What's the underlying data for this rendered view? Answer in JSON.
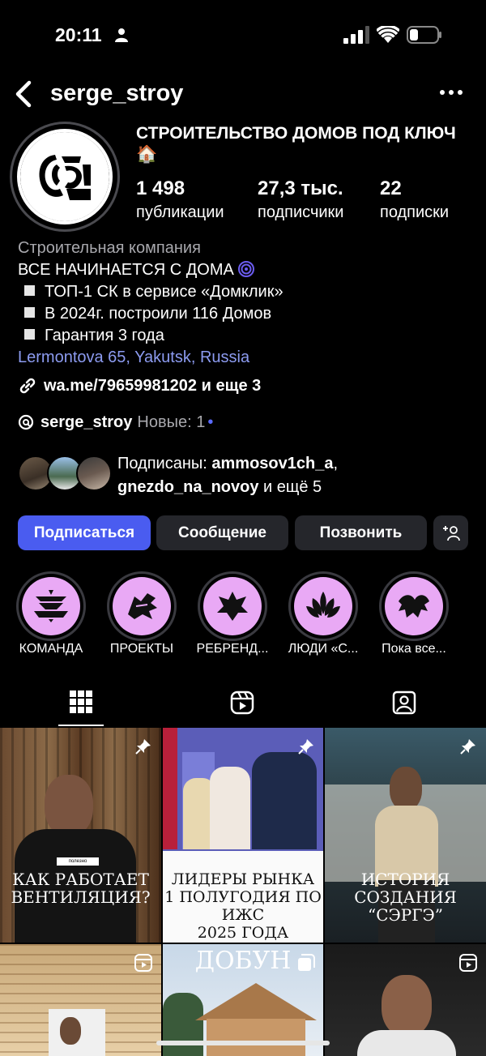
{
  "status": {
    "time": "20:11"
  },
  "header": {
    "username": "serge_stroy"
  },
  "profile": {
    "name": "СТРОИТЕЛЬСТВО ДОМОВ ПОД КЛЮЧ🏠",
    "stats": [
      {
        "value": "1 498",
        "label": "публикации"
      },
      {
        "value": "27,3 тыс.",
        "label": "подписчики"
      },
      {
        "value": "22",
        "label": "подписки"
      }
    ],
    "category": "Строительная компания",
    "bio_lines": [
      "ВСЕ НАЧИНАЕТСЯ С ДОМА",
      "ТОП-1 СК в сервисе «Домклик»",
      "В 2024г. построили 116 Домов",
      "Гарантия 3 года"
    ],
    "location": "Lermontova 65, Yakutsk, Russia",
    "link": "wa.me/79659981202 и еще 3",
    "threads_handle": "serge_stroy",
    "threads_new": "Новые: 1",
    "followed_prefix": "Подписаны: ",
    "followed_user1": "ammosov1ch_a",
    "followed_user2": "gnezdo_na_novoy",
    "followed_suffix": " и ещё 5"
  },
  "buttons": {
    "follow": "Подписаться",
    "message": "Сообщение",
    "call": "Позвонить"
  },
  "highlights": [
    {
      "label": "КОМАНДА"
    },
    {
      "label": "ПРОЕКТЫ"
    },
    {
      "label": "РЕБРЕНД..."
    },
    {
      "label": "ЛЮДИ «С..."
    },
    {
      "label": "Пока все..."
    }
  ],
  "posts": [
    {
      "title_line1": "КАК РАБОТАЕТ",
      "title_line2": "ВЕНТИЛЯЦИЯ?",
      "badge": "полезно"
    },
    {
      "title_line1": "ЛИДЕРЫ РЫНКА",
      "title_line2": "1 ПОЛУГОДИЯ ПО ИЖС",
      "title_line3": "2025 ГОДА"
    },
    {
      "title_line1": "ИСТОРИЯ СОЗДАНИЯ",
      "title_line2": "“СЭРГЭ”"
    },
    {
      "title_line1": ""
    },
    {
      "title_line1": "ДОБУН"
    },
    {
      "title_line1": ""
    }
  ],
  "colors": {
    "accent": "#4a5cf0",
    "highlight": "#e9a9f5",
    "location": "#8c9bf0"
  }
}
